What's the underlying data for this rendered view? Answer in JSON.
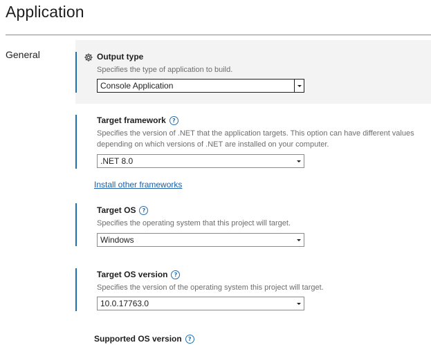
{
  "page": {
    "title": "Application",
    "nav_section": "General"
  },
  "settings": {
    "output_type": {
      "title": "Output type",
      "description": "Specifies the type of application to build.",
      "value": "Console Application"
    },
    "target_framework": {
      "title": "Target framework",
      "description_line1": "Specifies the version of .NET that the application targets. This option can have different values",
      "description_line2": "depending on which versions of .NET are installed on your computer.",
      "value": ".NET 8.0",
      "link": "Install other frameworks"
    },
    "target_os": {
      "title": "Target OS",
      "description": "Specifies the operating system that this project will target.",
      "value": "Windows"
    },
    "target_os_version": {
      "title": "Target OS version",
      "description": "Specifies the version of the operating system this project will target.",
      "value": "10.0.17763.0"
    },
    "supported_os_version": {
      "title": "Supported OS version"
    }
  },
  "icons": {
    "gear": "gear-icon",
    "help": "?"
  },
  "colors": {
    "accent": "#1e6eb4",
    "link": "#1a5fa8",
    "selected_bg": "#f3f3f3",
    "description": "#6d6d6d"
  }
}
